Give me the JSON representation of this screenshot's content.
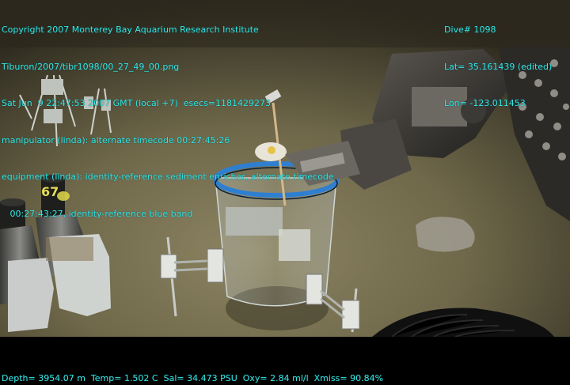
{
  "overlay": {
    "top_left_lines": [
      "Copyright 2007 Monterey Bay Aquarium Research Institute",
      "Tiburon/2007/tibr1098/00_27_49_00.png",
      "Sat Jun  9 22:47:53 2007 GMT (local +7)  esecs=1181429273",
      "manipulator (linda): alternate timecode 00:27:45:26",
      "equipment (linda): identity-reference sediment enricher, alternate timecode",
      "   00:27:43:27, identity-reference blue band"
    ],
    "top_right_lines": [
      "Dive# 1098",
      "Lat= 35.161439 (edited)",
      "Lon= -123.011453"
    ],
    "bottom_line": "Depth= 3954.07 m  Temp= 1.502 C  Sal= 34.473 PSU  Oxy= 2.84 ml/l  Xmiss= 90.84%"
  },
  "scene": {
    "marker_label": "67"
  },
  "colors": {
    "overlay_text": "#35e6e6",
    "seafloor": "#6b6446",
    "blue_band": "#2f7fd0"
  }
}
